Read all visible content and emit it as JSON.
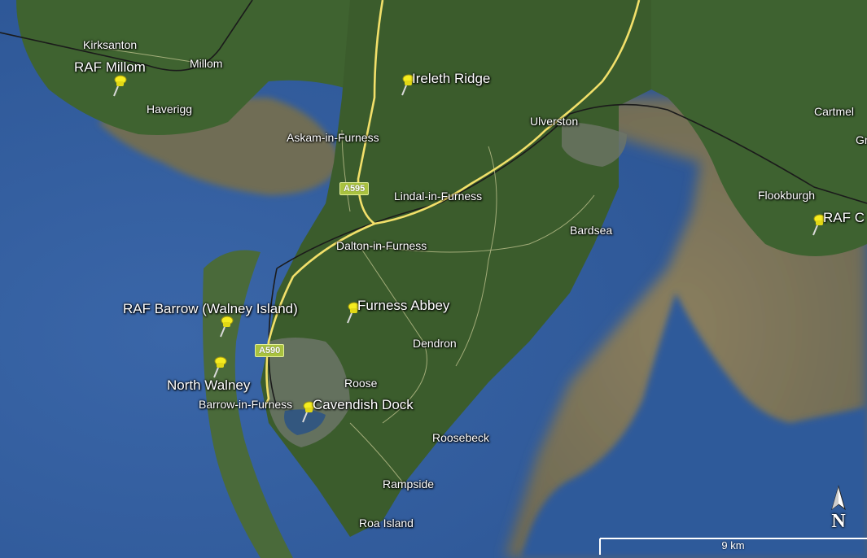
{
  "places": [
    {
      "id": "kirksanton",
      "label": "Kirksanton"
    },
    {
      "id": "millom",
      "label": "Millom"
    },
    {
      "id": "haverigg",
      "label": "Haverigg"
    },
    {
      "id": "askam",
      "label": "Askam-in-Furness"
    },
    {
      "id": "ulverston",
      "label": "Ulverston"
    },
    {
      "id": "cartmel",
      "label": "Cartmel"
    },
    {
      "id": "gr",
      "label": "Gr"
    },
    {
      "id": "flookburgh",
      "label": "Flookburgh"
    },
    {
      "id": "lindal",
      "label": "Lindal-in-Furness"
    },
    {
      "id": "bardsea",
      "label": "Bardsea"
    },
    {
      "id": "dalton",
      "label": "Dalton-in-Furness"
    },
    {
      "id": "dendron",
      "label": "Dendron"
    },
    {
      "id": "roose",
      "label": "Roose"
    },
    {
      "id": "barrow",
      "label": "Barrow-in-Furness"
    },
    {
      "id": "roosebeck",
      "label": "Roosebeck"
    },
    {
      "id": "rampside",
      "label": "Rampside"
    },
    {
      "id": "roa",
      "label": "Roa Island"
    }
  ],
  "placemarks": [
    {
      "id": "raf-millom",
      "label": "RAF Millom"
    },
    {
      "id": "ireleth-ridge",
      "label": "Ireleth Ridge"
    },
    {
      "id": "raf-cark",
      "label": "RAF C"
    },
    {
      "id": "raf-barrow",
      "label": "RAF Barrow (Walney Island)"
    },
    {
      "id": "furness-abbey",
      "label": "Furness Abbey"
    },
    {
      "id": "north-walney",
      "label": "North Walney"
    },
    {
      "id": "cavendish-dock",
      "label": "Cavendish Dock"
    }
  ],
  "road_shields": [
    {
      "id": "a595",
      "label": "A595"
    },
    {
      "id": "a590",
      "label": "A590"
    }
  ],
  "compass": {
    "label": "N"
  },
  "scale": {
    "label": "9 km"
  },
  "colors": {
    "sea": "#2f5a9a",
    "land": "#3d5f2e",
    "mudflat": "#7d7356",
    "main_road": "#f2e06a",
    "railway": "#1b1b1b",
    "pin": "#f5ec1f"
  }
}
